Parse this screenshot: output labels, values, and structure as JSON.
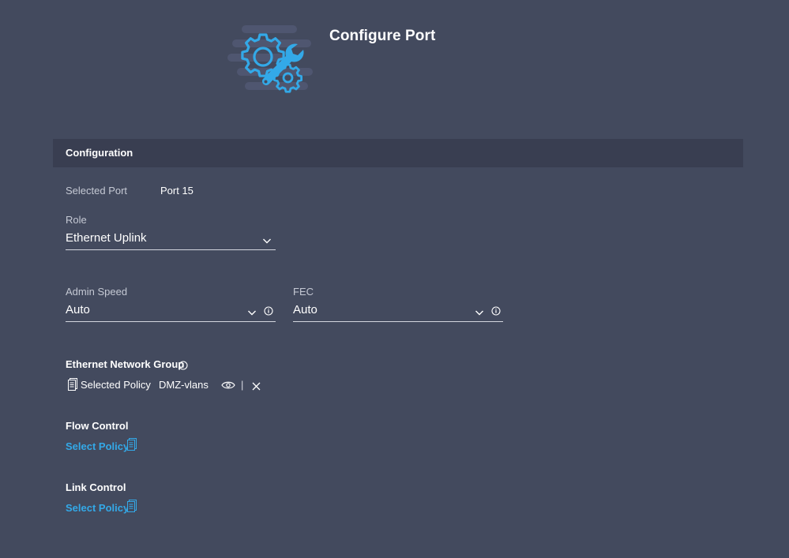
{
  "header": {
    "title": "Configure Port",
    "icon": "gear-wrench-icon"
  },
  "section": {
    "title": "Configuration"
  },
  "selected_port": {
    "label": "Selected Port",
    "value": "Port 15"
  },
  "role": {
    "label": "Role",
    "value": "Ethernet Uplink"
  },
  "admin_speed": {
    "label": "Admin Speed",
    "value": "Auto"
  },
  "fec": {
    "label": "FEC",
    "value": "Auto"
  },
  "ethernet_network_group": {
    "label": "Ethernet Network Group",
    "selected_label": "Selected Policy",
    "policy_name": "DMZ-vlans",
    "separator": "|"
  },
  "flow_control": {
    "label": "Flow Control",
    "link": "Select Policy"
  },
  "link_control": {
    "label": "Link Control",
    "link": "Select Policy"
  },
  "colors": {
    "background": "#434a5e",
    "section_header": "#393e51",
    "accent": "#33a9e8",
    "text": "#ffffff",
    "muted_text": "#c5c9d4"
  }
}
